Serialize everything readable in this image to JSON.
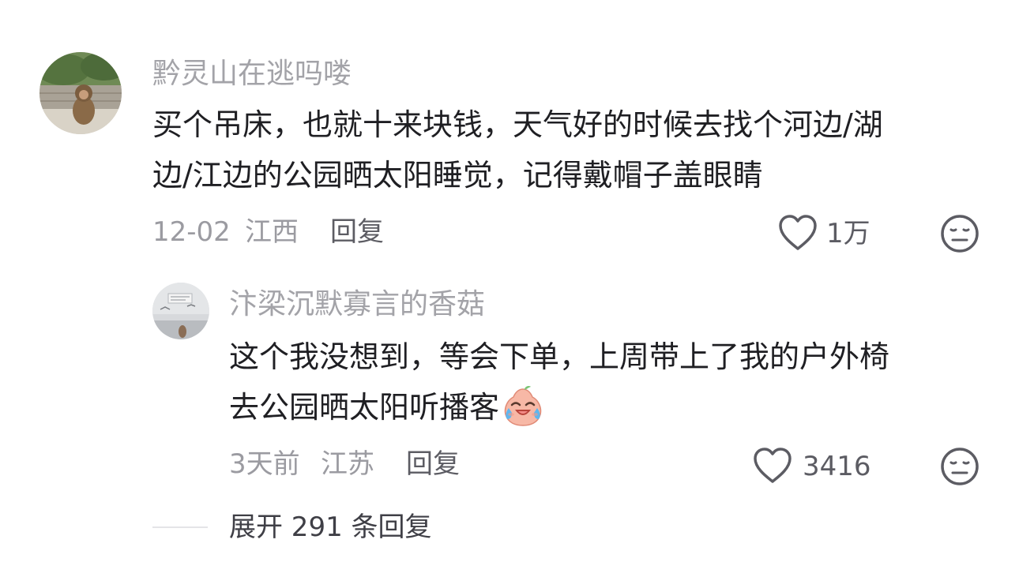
{
  "comment": {
    "username": "黔灵山在逃吗喽",
    "text_line1": "买个吊床，也就十来块钱，天气好的时候去找个河边/湖",
    "text_line2": "边/江边的公园晒太阳睡觉，记得戴帽子盖眼睛",
    "date": "12-02",
    "location": "江西",
    "reply_label": "回复",
    "like_count": "1万"
  },
  "reply": {
    "username": "汴梁沉默寡言的香菇",
    "text_line1": "这个我没想到，等会下单，上周带上了我的户外椅",
    "text_line2": "去公园晒太阳听播客",
    "emoji": "crying-laughing-emoji",
    "date": "3天前",
    "location": "江苏",
    "reply_label": "回复",
    "like_count": "3416"
  },
  "expand": {
    "label": "展开 291 条回复"
  }
}
